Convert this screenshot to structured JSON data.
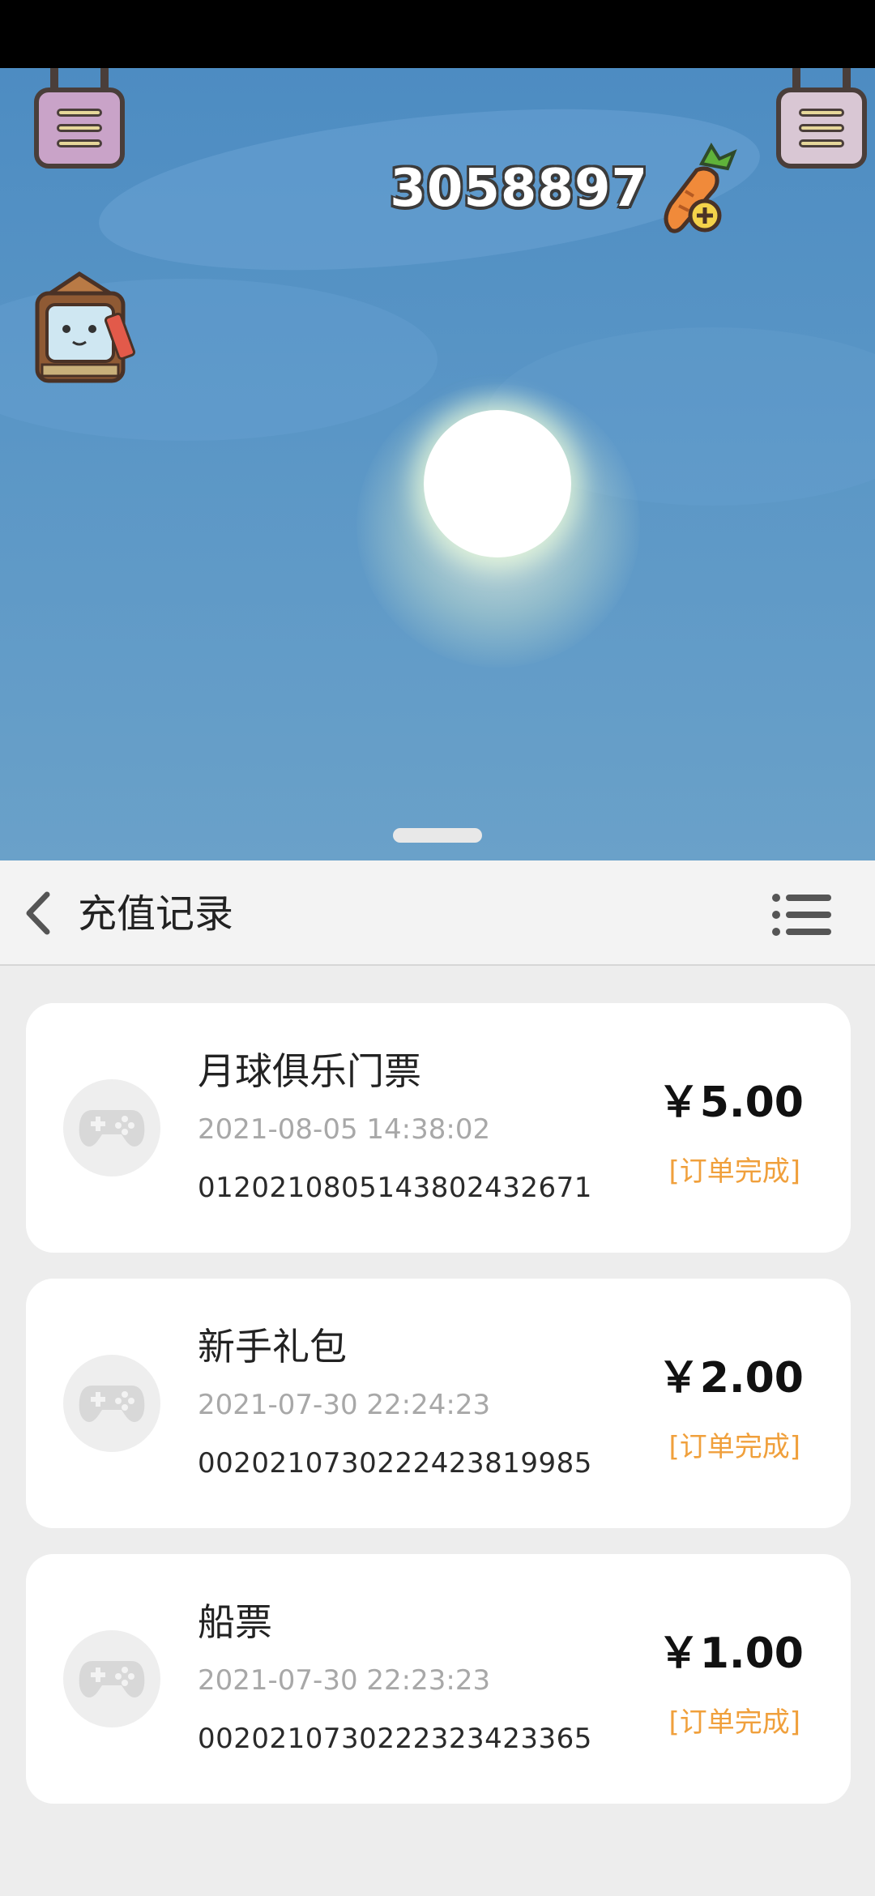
{
  "game": {
    "coin_count": "3058897"
  },
  "header": {
    "title": "充值记录"
  },
  "records": [
    {
      "name": "月球俱乐门票",
      "time": "2021-08-05 14:38:02",
      "order_id": "0120210805143802432671",
      "price": "￥5.00",
      "status": "[订单完成]"
    },
    {
      "name": "新手礼包",
      "time": "2021-07-30 22:24:23",
      "order_id": "0020210730222423819985",
      "price": "￥2.00",
      "status": "[订单完成]"
    },
    {
      "name": "船票",
      "time": "2021-07-30 22:23:23",
      "order_id": "0020210730222323423365",
      "price": "￥1.00",
      "status": "[订单完成]"
    }
  ],
  "colors": {
    "accent_status": "#f0a03c",
    "sky": "#5a96c6"
  },
  "icons": {
    "back": "chevron-left-icon",
    "menu": "list-icon",
    "record_avatar": "gamepad-icon"
  }
}
